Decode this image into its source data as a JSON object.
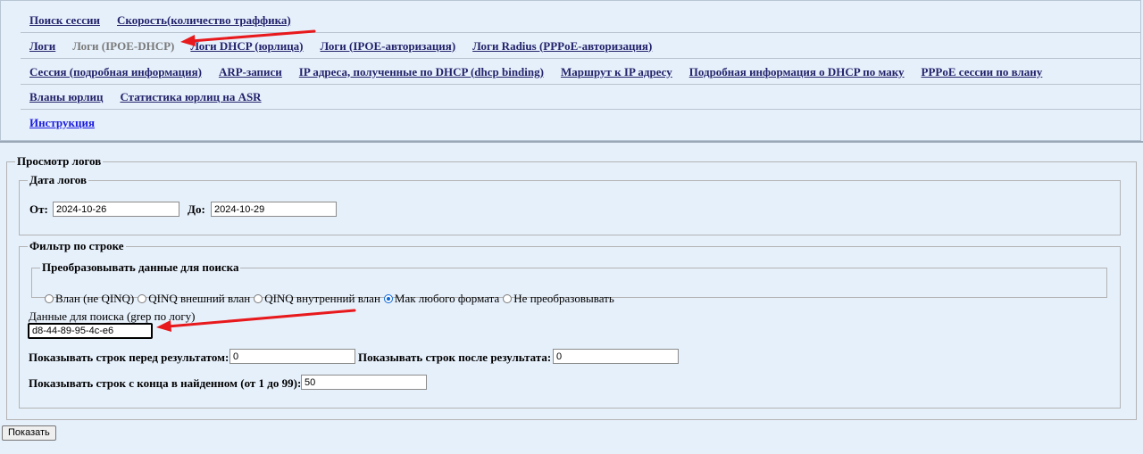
{
  "nav": {
    "row1": [
      "Поиск сессии",
      "Скорость(количество траффика)"
    ],
    "row2": [
      "Логи",
      "Логи (IPOE-DHCP)",
      "Логи DHCP (юрлица)",
      "Логи (IPOE-авторизация)",
      "Логи Radius (PPPoE-авторизация)"
    ],
    "row3": [
      "Сессия (подробная информация)",
      "ARP-записи",
      "IP адреса, полученные по DHCP (dhcp binding)",
      "Маршрут к IP адресу",
      "Подробная информация о DHCP по маку",
      "PPPoE сессии по влану"
    ],
    "row4": [
      "Вланы юрлиц",
      "Статистика юрлиц на ASR"
    ],
    "row5": [
      "Инструкция"
    ]
  },
  "form": {
    "legend": "Просмотр логов",
    "dates": {
      "legend": "Дата логов",
      "from_label": "От:",
      "from_value": "2024-10-26",
      "to_label": "До:",
      "to_value": "2024-10-29"
    },
    "filter": {
      "legend": "Фильтр по строке",
      "convert_legend": "Преобразовывать данные для поиска",
      "options": [
        "Влан (не QINQ)",
        "QINQ внешний влан",
        "QINQ внутренний влан",
        "Мак любого формата",
        "Не преобразовывать"
      ],
      "selected": "Мак любого формата",
      "search_label": "Данные для поиска (grep по логу)",
      "search_value": "d8-44-89-95-4c-e6",
      "before_label": "Показывать строк перед результатом:",
      "before_value": "0",
      "after_label": "Показывать строк после результата:",
      "after_value": "0",
      "tail_label": "Показывать строк с конца в найденном (от 1 до 99):",
      "tail_value": "50"
    },
    "submit_label": "Показать"
  },
  "colors": {
    "background": "#e6f0fb",
    "link": "#23236b",
    "annotation_arrow": "#e8191c"
  }
}
